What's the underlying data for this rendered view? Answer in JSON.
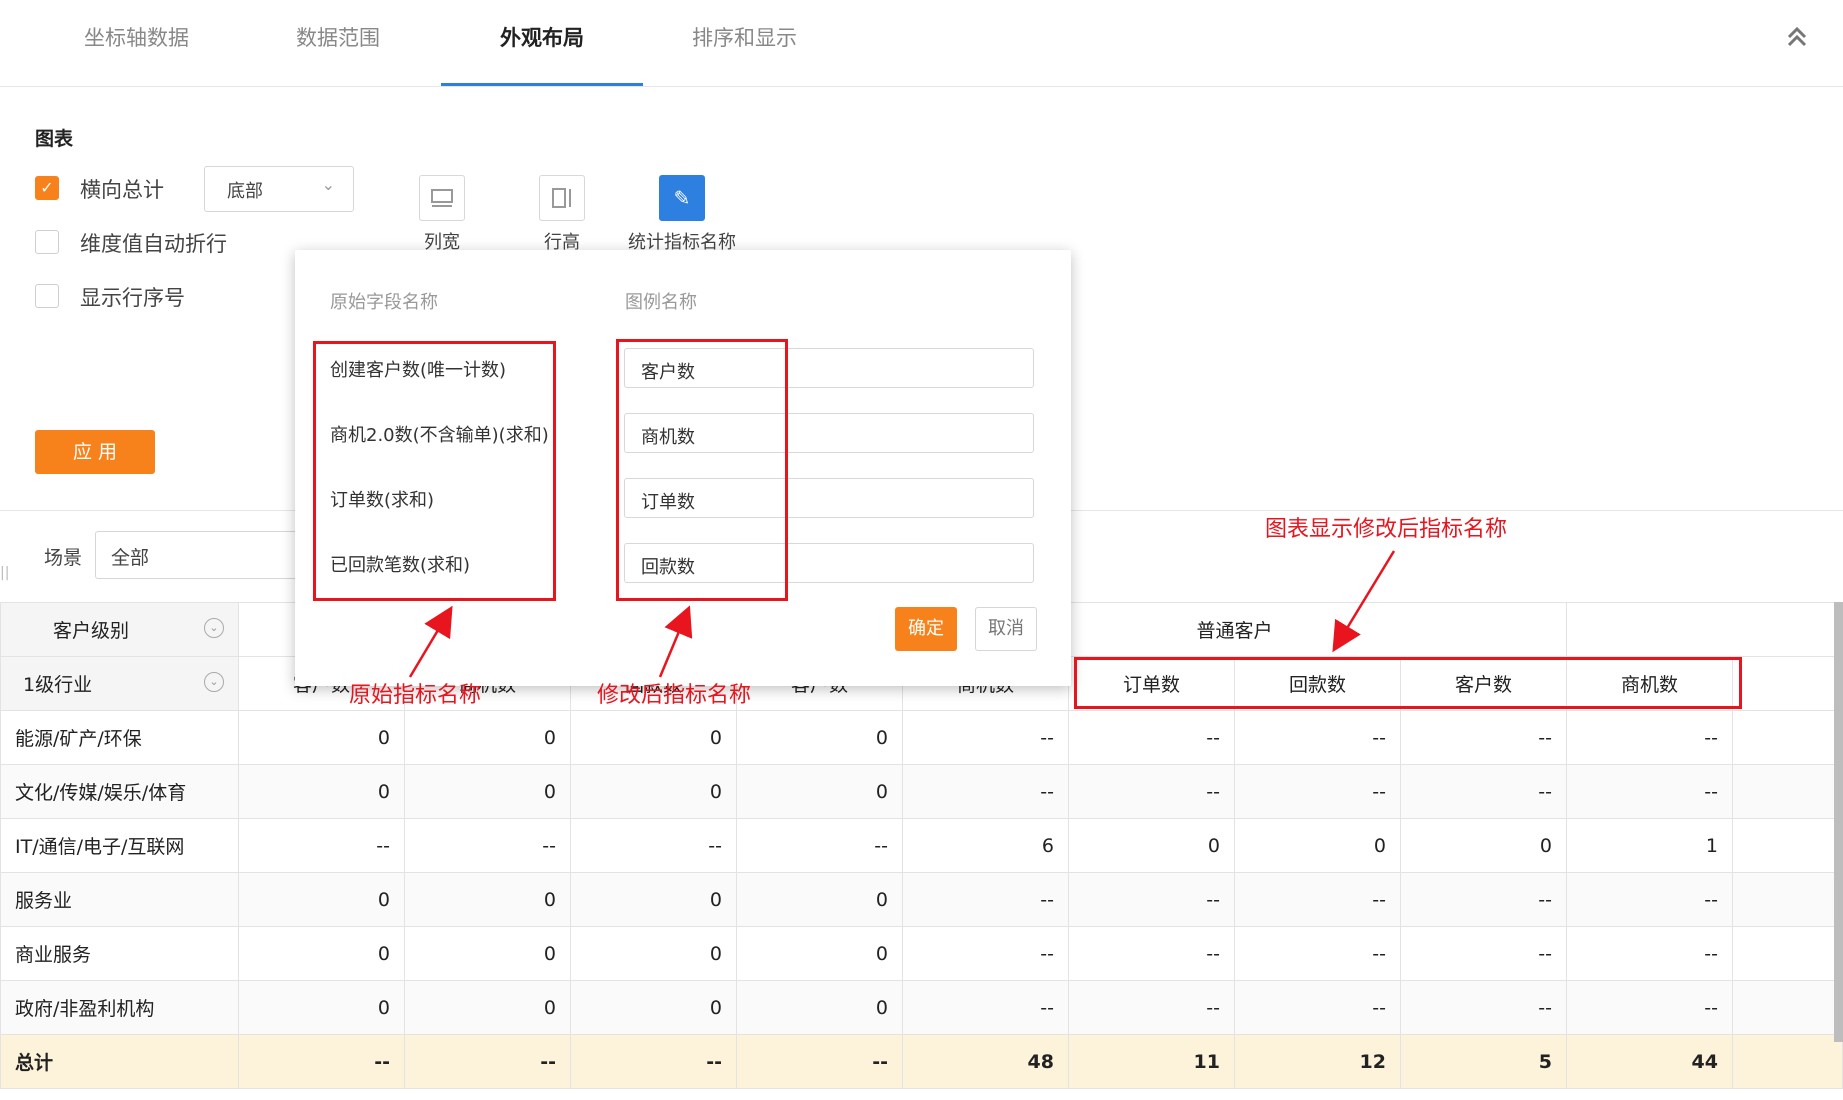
{
  "tabs": [
    "坐标轴数据",
    "数据范围",
    "外观布局",
    "排序和显示"
  ],
  "active_tab": "外观布局",
  "collapse_icon": "double-chevron-up-icon",
  "settings": {
    "section_title": "图表",
    "horizontal_total": {
      "label": "横向总计",
      "checked": true
    },
    "position_select": "底部",
    "auto_wrap": {
      "label": "维度值自动折行",
      "checked": false
    },
    "row_number": {
      "label": "显示行序号",
      "checked": false
    },
    "col_width": "列宽",
    "row_height": "行高",
    "metric_name": "统计指标名称",
    "apply": "应 用"
  },
  "filter": {
    "label": "场景",
    "value": "全部"
  },
  "dialog": {
    "col1": "原始字段名称",
    "col2": "图例名称",
    "originals": [
      "创建客户数(唯一计数)",
      "商机2.0数(不含输单)(求和)",
      "订单数(求和)",
      "已回款笔数(求和)"
    ],
    "legends": [
      "客户数",
      "商机数",
      "订单数",
      "回款数"
    ],
    "ok": "确定",
    "cancel": "取消"
  },
  "table": {
    "dim1": "客户级别",
    "dim2": "1级行业",
    "group_header": "普通客户",
    "sub_headers": [
      "商机数",
      "订单数",
      "回款数",
      "客户数",
      "商机数"
    ],
    "partial_headers": [
      "客户数",
      "商机数",
      "回款数",
      "客户数"
    ],
    "rows": [
      {
        "name": "能源/矿产/环保",
        "cells": [
          "0",
          "0",
          "0",
          "0",
          "--",
          "--",
          "--",
          "--",
          "--"
        ]
      },
      {
        "name": "文化/传媒/娱乐/体育",
        "cells": [
          "0",
          "0",
          "0",
          "0",
          "--",
          "--",
          "--",
          "--",
          "--"
        ]
      },
      {
        "name": "IT/通信/电子/互联网",
        "cells": [
          "--",
          "--",
          "--",
          "--",
          "6",
          "0",
          "0",
          "0",
          "1"
        ]
      },
      {
        "name": "服务业",
        "cells": [
          "0",
          "0",
          "0",
          "0",
          "--",
          "--",
          "--",
          "--",
          "--"
        ]
      },
      {
        "name": "商业服务",
        "cells": [
          "0",
          "0",
          "0",
          "0",
          "--",
          "--",
          "--",
          "--",
          "--"
        ]
      },
      {
        "name": "政府/非盈利机构",
        "cells": [
          "0",
          "0",
          "0",
          "0",
          "--",
          "--",
          "--",
          "--",
          "--"
        ]
      }
    ],
    "total": {
      "name": "总计",
      "cells": [
        "--",
        "--",
        "--",
        "--",
        "48",
        "11",
        "12",
        "5",
        "44"
      ]
    }
  },
  "annotations": {
    "original": "原始指标名称",
    "modified": "修改后指标名称",
    "chart_display": "图表显示修改后指标名称"
  },
  "colors": {
    "accent": "#f7821b",
    "blue": "#2d7fe0",
    "annotation": "#e8141e",
    "total_row": "#fdf3da"
  }
}
